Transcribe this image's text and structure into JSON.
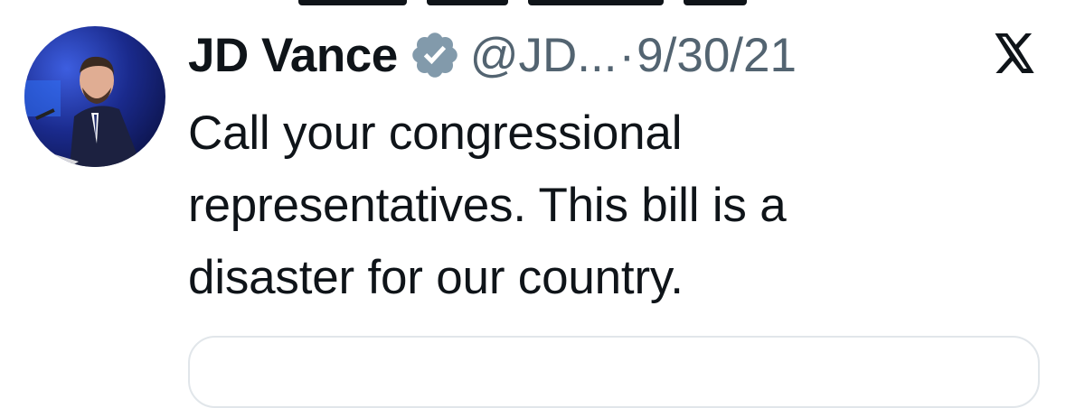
{
  "tweet": {
    "display_name": "JD Vance",
    "handle": "@JD...",
    "separator": "·",
    "timestamp": "9/30/21",
    "text_lines": [
      "Call your congressional",
      "representatives. This bill is a",
      "disaster for our country."
    ]
  },
  "icons": {
    "verified": "verified-badge-icon",
    "platform": "x-logo-icon"
  },
  "colors": {
    "text_primary": "#0f1419",
    "text_secondary": "#536471",
    "verified_badge": "#829aab",
    "card_border": "#e1e6ea"
  }
}
